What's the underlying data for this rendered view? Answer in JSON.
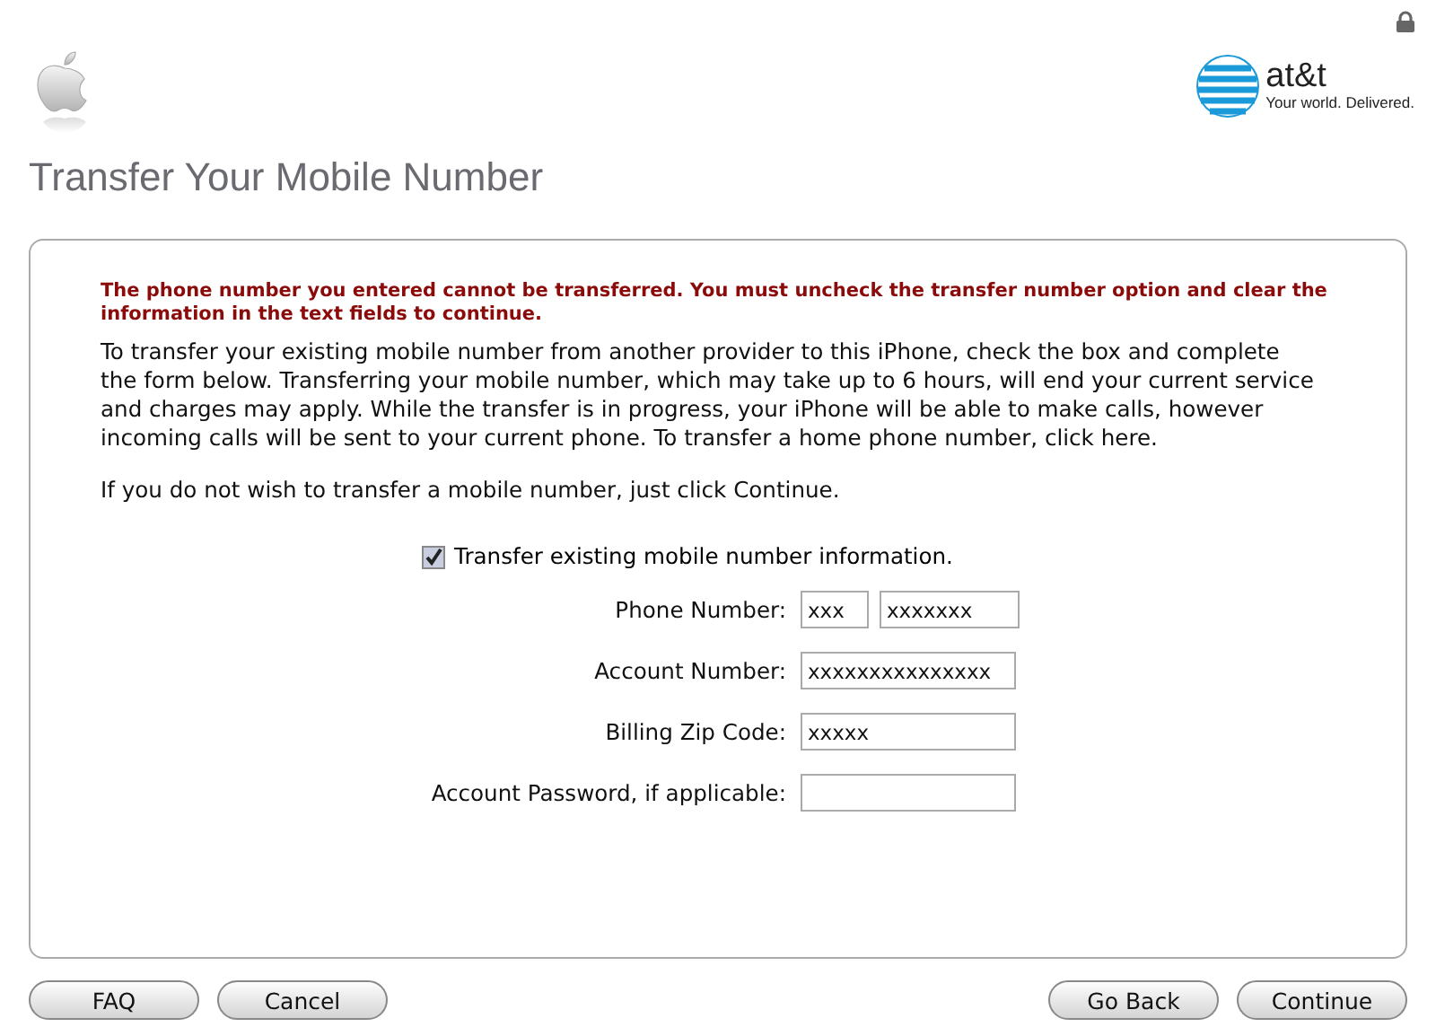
{
  "header": {
    "brand_name": "at&t",
    "brand_tagline": "Your world. Delivered.",
    "title": "Transfer Your Mobile Number"
  },
  "error": "The phone number you entered cannot be transferred. You must uncheck the transfer number option and clear the information in the text fields to continue.",
  "paragraphs": [
    "To transfer your existing mobile number from another provider to this iPhone, check the box and complete the form below. Transferring your mobile number, which may take up to 6 hours, will end your current service and charges may apply. While the transfer is in progress, your iPhone will be able to make calls, however incoming calls will be sent to your current phone. To transfer a home phone number, click here.",
    "If you do not wish to transfer a mobile number, just click Continue."
  ],
  "transfer_checkbox": {
    "label": "Transfer existing mobile number information.",
    "checked": true
  },
  "fields": [
    {
      "label": "Phone Number:",
      "inputs": [
        {
          "value": "xxx"
        },
        {
          "value": "xxxxxxx"
        }
      ]
    },
    {
      "label": "Account Number:",
      "inputs": [
        {
          "value": "xxxxxxxxxxxxxxx"
        }
      ]
    },
    {
      "label": "Billing Zip Code:",
      "inputs": [
        {
          "value": "xxxxx"
        }
      ]
    },
    {
      "label": "Account Password, if applicable:"
    }
  ],
  "buttons_left": [
    "FAQ",
    "Cancel"
  ],
  "buttons_right": [
    "Go Back",
    "Continue"
  ]
}
